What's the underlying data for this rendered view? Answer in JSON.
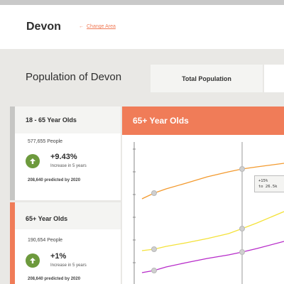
{
  "header": {
    "area_title": "Devon",
    "change_area_arrow": "←",
    "change_area_label": "Change Area"
  },
  "section_title": "Population of Devon",
  "tabs": [
    {
      "label": "Total Population"
    }
  ],
  "cards": [
    {
      "title": "18 - 65 Year Olds",
      "people": "577,655 People",
      "change": "+9.43%",
      "change_note": "Increase in 5 years",
      "predicted": "208,640 predicted by 2020"
    },
    {
      "title": "65+ Year Olds",
      "people": "190,654 People",
      "change": "+1%",
      "change_note": "Increase in 5 years",
      "predicted": "208,640 predicted by 2020"
    }
  ],
  "chart": {
    "title": "65+ Year Olds",
    "tooltip_line1": "+15%",
    "tooltip_line2": "to 26.5k",
    "colors": {
      "orange": "#f39a2e",
      "yellow": "#f4e23a",
      "purple": "#b72bc9",
      "marker": "#cfcfcf",
      "axis": "#888888",
      "accent": "#f07c58",
      "up": "#6d9a3d"
    }
  }
}
